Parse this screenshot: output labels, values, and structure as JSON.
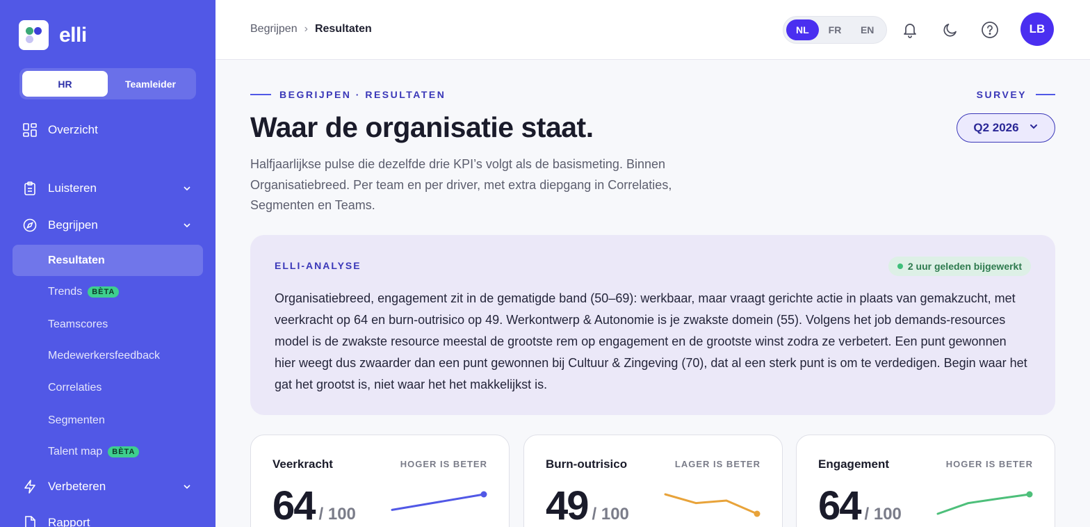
{
  "brand": {
    "name": "elli"
  },
  "role_toggle": {
    "hr": "HR",
    "teamleader": "Teamleider"
  },
  "sidebar": {
    "overview": "Overzicht",
    "listen": "Luisteren",
    "understand": "Begrijpen",
    "sub": {
      "results": "Resultaten",
      "trends": "Trends",
      "teamscores": "Teamscores",
      "feedback": "Medewerkersfeedback",
      "correlations": "Correlaties",
      "segments": "Segmenten",
      "talent_map": "Talent map"
    },
    "beta_label": "BÈTA",
    "improve": "Verbeteren",
    "report": "Rapport"
  },
  "topbar": {
    "breadcrumb_parent": "Begrijpen",
    "breadcrumb_sep": "›",
    "breadcrumb_current": "Resultaten",
    "lang": [
      "NL",
      "FR",
      "EN"
    ],
    "avatar": "LB"
  },
  "header": {
    "eyebrow": "BEGRIJPEN · RESULTATEN",
    "survey_label": "SURVEY",
    "survey_value": "Q2 2026",
    "title": "Waar de organisatie staat.",
    "description": "Halfjaarlijkse pulse die dezelfde drie KPI’s volgt als de basismeting. Binnen Organisatiebreed. Per team en per driver, met extra diepgang in Correlaties, Segmenten en Teams."
  },
  "analysis": {
    "label": "ELLI-ANALYSE",
    "updated": "2 uur geleden bijgewerkt",
    "text": "Organisatiebreed, engagement zit in de gematigde band (50–69): werkbaar, maar vraagt gerichte actie in plaats van gemakzucht, met veerkracht op 64 en burn-outrisico op 49. Werkontwerp & Autonomie is je zwakste domein (55). Volgens het job demands-resources model is de zwakste resource meestal de grootste rem op engagement en de grootste winst zodra ze verbetert. Een punt gewonnen hier weegt dus zwaarder dan een punt gewonnen bij Cultuur & Zingeving (70), dat al een sterk punt is om te verdedigen. Begin waar het gat het grootst is, niet waar het het makkelijkst is."
  },
  "kpis": [
    {
      "name": "Veerkracht",
      "hint": "HOGER IS BETER",
      "value": "64",
      "max": "/ 100",
      "color": "#5158e6",
      "trend": [
        0.2,
        1.0
      ]
    },
    {
      "name": "Burn-outrisico",
      "hint": "LAGER IS BETER",
      "value": "49",
      "max": "/ 100",
      "color": "#e8a33a",
      "trend": [
        1.0,
        0.55,
        0.68,
        0.0
      ]
    },
    {
      "name": "Engagement",
      "hint": "HOGER IS BETER",
      "value": "64",
      "max": "/ 100",
      "color": "#4dbf7a",
      "trend": [
        0.0,
        0.55,
        0.78,
        1.0
      ]
    }
  ]
}
